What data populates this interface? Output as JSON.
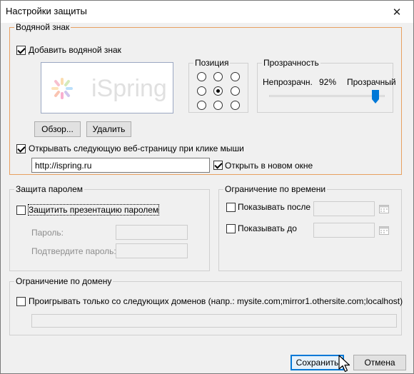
{
  "window": {
    "title": "Настройки защиты",
    "close_glyph": "✕"
  },
  "watermark": {
    "group_label": "Водяной знак",
    "add_checkbox_label": "Добавить водяной знак",
    "add_checked": true,
    "preview_logo_text": "iSpring",
    "browse_button": "Обзор...",
    "delete_button": "Удалить",
    "position": {
      "label": "Позиция",
      "selected": "center"
    },
    "transparency": {
      "label": "Прозрачность",
      "left_label": "Непрозрачн.",
      "value_text": "92%",
      "value": 92,
      "right_label": "Прозрачный"
    },
    "open_url_label": "Открывать следующую веб-страницу при клике мыши",
    "open_url_checked": true,
    "url_value": "http://ispring.ru",
    "new_window_label": "Открыть в новом окне",
    "new_window_checked": true,
    "highlight_color": "#e8a060"
  },
  "password": {
    "group_label": "Защита паролем",
    "protect_label": "Защитить презентацию паролем",
    "protect_checked": false,
    "password_label": "Пароль:",
    "confirm_label": "Подтвердите пароль:"
  },
  "time_limit": {
    "group_label": "Ограничение по времени",
    "show_after_label": "Показывать после",
    "show_until_label": "Показывать до"
  },
  "domain": {
    "group_label": "Ограничение по домену",
    "only_domains_label": "Проигрывать только со следующих доменов (напр.: mysite.com;mirror1.othersite.com;localhost)"
  },
  "buttons": {
    "save": "Сохранить",
    "cancel": "Отмена"
  }
}
